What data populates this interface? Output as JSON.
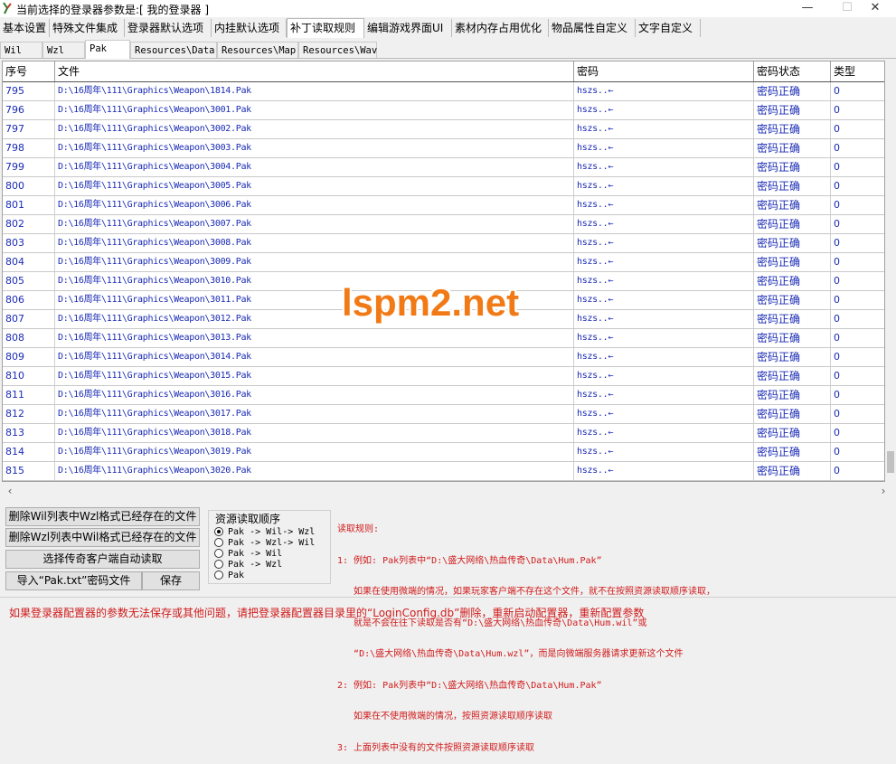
{
  "window": {
    "title": "当前选择的登录器参数是:[ 我的登录器 ]",
    "min": "—",
    "max": "☐",
    "close": "✕"
  },
  "main_tabs": [
    "基本设置",
    "特殊文件集成",
    "登录器默认选项",
    "内挂默认选项",
    "补丁读取规则",
    "编辑游戏界面UI",
    "素材内存占用优化",
    "物品属性自定义",
    "文字自定义"
  ],
  "sub_tabs": [
    "Wil",
    "Wzl",
    "Pak",
    "Resources\\Data",
    "Resources\\Map",
    "Resources\\Wav"
  ],
  "table": {
    "headers": [
      "序号",
      "文件",
      "密码",
      "密码状态",
      "类型"
    ],
    "rows": [
      [
        "795",
        "D:\\16周年\\111\\Graphics\\Weapon\\1814.Pak",
        "hszs..←",
        "密码正确",
        "0"
      ],
      [
        "796",
        "D:\\16周年\\111\\Graphics\\Weapon\\3001.Pak",
        "hszs..←",
        "密码正确",
        "0"
      ],
      [
        "797",
        "D:\\16周年\\111\\Graphics\\Weapon\\3002.Pak",
        "hszs..←",
        "密码正确",
        "0"
      ],
      [
        "798",
        "D:\\16周年\\111\\Graphics\\Weapon\\3003.Pak",
        "hszs..←",
        "密码正确",
        "0"
      ],
      [
        "799",
        "D:\\16周年\\111\\Graphics\\Weapon\\3004.Pak",
        "hszs..←",
        "密码正确",
        "0"
      ],
      [
        "800",
        "D:\\16周年\\111\\Graphics\\Weapon\\3005.Pak",
        "hszs..←",
        "密码正确",
        "0"
      ],
      [
        "801",
        "D:\\16周年\\111\\Graphics\\Weapon\\3006.Pak",
        "hszs..←",
        "密码正确",
        "0"
      ],
      [
        "802",
        "D:\\16周年\\111\\Graphics\\Weapon\\3007.Pak",
        "hszs..←",
        "密码正确",
        "0"
      ],
      [
        "803",
        "D:\\16周年\\111\\Graphics\\Weapon\\3008.Pak",
        "hszs..←",
        "密码正确",
        "0"
      ],
      [
        "804",
        "D:\\16周年\\111\\Graphics\\Weapon\\3009.Pak",
        "hszs..←",
        "密码正确",
        "0"
      ],
      [
        "805",
        "D:\\16周年\\111\\Graphics\\Weapon\\3010.Pak",
        "hszs..←",
        "密码正确",
        "0"
      ],
      [
        "806",
        "D:\\16周年\\111\\Graphics\\Weapon\\3011.Pak",
        "hszs..←",
        "密码正确",
        "0"
      ],
      [
        "807",
        "D:\\16周年\\111\\Graphics\\Weapon\\3012.Pak",
        "hszs..←",
        "密码正确",
        "0"
      ],
      [
        "808",
        "D:\\16周年\\111\\Graphics\\Weapon\\3013.Pak",
        "hszs..←",
        "密码正确",
        "0"
      ],
      [
        "809",
        "D:\\16周年\\111\\Graphics\\Weapon\\3014.Pak",
        "hszs..←",
        "密码正确",
        "0"
      ],
      [
        "810",
        "D:\\16周年\\111\\Graphics\\Weapon\\3015.Pak",
        "hszs..←",
        "密码正确",
        "0"
      ],
      [
        "811",
        "D:\\16周年\\111\\Graphics\\Weapon\\3016.Pak",
        "hszs..←",
        "密码正确",
        "0"
      ],
      [
        "812",
        "D:\\16周年\\111\\Graphics\\Weapon\\3017.Pak",
        "hszs..←",
        "密码正确",
        "0"
      ],
      [
        "813",
        "D:\\16周年\\111\\Graphics\\Weapon\\3018.Pak",
        "hszs..←",
        "密码正确",
        "0"
      ],
      [
        "814",
        "D:\\16周年\\111\\Graphics\\Weapon\\3019.Pak",
        "hszs..←",
        "密码正确",
        "0"
      ],
      [
        "815",
        "D:\\16周年\\111\\Graphics\\Weapon\\3020.Pak",
        "hszs..←",
        "密码正确",
        "0"
      ]
    ]
  },
  "watermark": "lspm2.net",
  "buttons": {
    "delete_wil": "删除Wil列表中Wzl格式已经存在的文件",
    "delete_wzl": "删除Wzl列表中Wil格式已经存在的文件",
    "select_client": "选择传奇客户端自动读取",
    "import_pak": "导入“Pak.txt”密码文件",
    "save": "保存"
  },
  "read_order": {
    "title": "资源读取顺序",
    "options": [
      "Pak -> Wil-> Wzl",
      "Pak -> Wzl-> Wil",
      "Pak -> Wil",
      "Pak -> Wzl",
      "Pak"
    ],
    "selected_index": 0
  },
  "rules": {
    "lines": [
      "读取规则:",
      "1: 例如: Pak列表中“D:\\盛大网络\\热血传奇\\Data\\Hum.Pak”",
      "   如果在使用微端的情况，如果玩家客户端不存在这个文件，就不在按照资源读取顺序读取，",
      "   就是不会在往下读取是否有“D:\\盛大网络\\热血传奇\\Data\\Hum.wil”或",
      "   “D:\\盛大网络\\热血传奇\\Data\\Hum.wzl”，而是向微端服务器请求更新这个文件",
      "2: 例如: Pak列表中“D:\\盛大网络\\热血传奇\\Data\\Hum.Pak”",
      "   如果在不使用微端的情况，按照资源读取顺序读取",
      "3: 上面列表中没有的文件按照资源读取顺序读取"
    ]
  },
  "footer": {
    "text": "如果登录器配置器的参数无法保存或其他问题，请把登录器配置器目录里的“LoginConfig.db”删除，重新启动配置器，重新配置参数"
  },
  "colors": {
    "link_blue": "#1a2bb5",
    "rule_red": "#d11a1a",
    "watermark_orange": "#f27a16"
  }
}
